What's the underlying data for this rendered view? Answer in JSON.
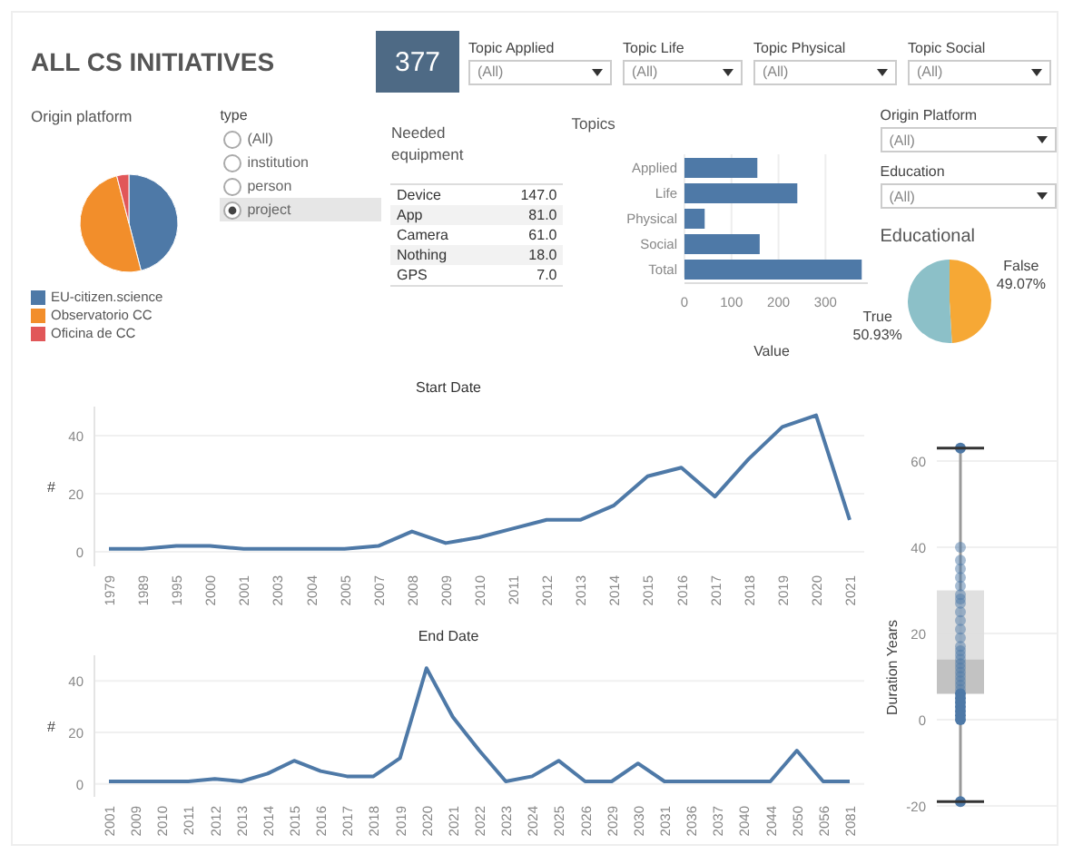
{
  "header": {
    "title": "ALL CS INITIATIVES",
    "count": "377"
  },
  "topic_filters": [
    {
      "label": "Topic Applied",
      "value": "(All)"
    },
    {
      "label": "Topic Life",
      "value": "(All)"
    },
    {
      "label": "Topic Physical",
      "value": "(All)"
    },
    {
      "label": "Topic Social",
      "value": "(All)"
    }
  ],
  "origin_platform": {
    "title": "Origin platform",
    "legend": [
      {
        "label": "EU-citizen.science",
        "color": "#4e79a7"
      },
      {
        "label": "Observatorio CC",
        "color": "#f28e2b"
      },
      {
        "label": "Oficina de CC",
        "color": "#e15759"
      }
    ]
  },
  "type_filter": {
    "title": "type",
    "options": [
      {
        "label": "(All)",
        "selected": false
      },
      {
        "label": "institution",
        "selected": false
      },
      {
        "label": "person",
        "selected": false
      },
      {
        "label": "project",
        "selected": true
      }
    ]
  },
  "needed_equipment": {
    "title": "Needed equipment",
    "rows": [
      {
        "name": "Device",
        "value": "147.0"
      },
      {
        "name": "App",
        "value": "81.0"
      },
      {
        "name": "Camera",
        "value": "61.0"
      },
      {
        "name": "Nothing",
        "value": "18.0"
      },
      {
        "name": "GPS",
        "value": "7.0"
      }
    ]
  },
  "topics": {
    "title": "Topics",
    "chart_data": {
      "type": "bar",
      "orientation": "horizontal",
      "xlabel": "Value",
      "categories": [
        "Applied",
        "Life",
        "Physical",
        "Social",
        "Total"
      ],
      "series": [
        {
          "color": "#4e79a7",
          "values": [
            155,
            240,
            43,
            160,
            377
          ]
        }
      ],
      "xticks": [
        0,
        100,
        200,
        300
      ],
      "xlim": [
        0,
        390
      ],
      "grid": true
    }
  },
  "side_filters": [
    {
      "label": "Origin Platform",
      "value": "(All)"
    },
    {
      "label": "Education",
      "value": "(All)"
    }
  ],
  "educational": {
    "title": "Educational",
    "chart_data": {
      "type": "pie",
      "categories": [
        "False",
        "True"
      ],
      "values": [
        49.07,
        50.93
      ],
      "value_labels": [
        "49.07%",
        "50.93%"
      ]
    }
  },
  "start_date": {
    "chart_data": {
      "type": "line",
      "title": "Start Date",
      "ylabel": "#",
      "categories": [
        "1979",
        "1989",
        "1995",
        "2000",
        "2001",
        "2003",
        "2004",
        "2005",
        "2007",
        "2008",
        "2009",
        "2010",
        "2011",
        "2012",
        "2013",
        "2014",
        "2015",
        "2016",
        "2017",
        "2018",
        "2019",
        "2020",
        "2021"
      ],
      "series": [
        {
          "color": "#4e79a7",
          "values": [
            1,
            1,
            2,
            2,
            1,
            1,
            1,
            1,
            2,
            7,
            3,
            5,
            8,
            11,
            11,
            16,
            26,
            29,
            19,
            32,
            43,
            47,
            11
          ]
        }
      ],
      "yticks": [
        0,
        20,
        40
      ],
      "ylim": [
        -5,
        50
      ],
      "grid": true
    }
  },
  "end_date": {
    "chart_data": {
      "type": "line",
      "title": "End Date",
      "ylabel": "#",
      "categories": [
        "2001",
        "2009",
        "2010",
        "2011",
        "2012",
        "2013",
        "2014",
        "2015",
        "2016",
        "2017",
        "2018",
        "2019",
        "2020",
        "2021",
        "2022",
        "2023",
        "2024",
        "2025",
        "2026",
        "2029",
        "2030",
        "2031",
        "2036",
        "2037",
        "2040",
        "2044",
        "2050",
        "2056",
        "2081"
      ],
      "series": [
        {
          "color": "#4e79a7",
          "values": [
            1,
            1,
            1,
            1,
            2,
            1,
            4,
            9,
            5,
            3,
            3,
            10,
            45,
            26,
            13,
            1,
            3,
            9,
            1,
            1,
            8,
            1,
            1,
            1,
            1,
            1,
            13,
            1,
            1
          ]
        }
      ],
      "yticks": [
        0,
        20,
        40
      ],
      "ylim": [
        -5,
        50
      ],
      "grid": true
    }
  },
  "duration": {
    "ylabel": "Duration Years",
    "yticks": [
      "60",
      "40",
      "20",
      "0",
      "-20"
    ]
  }
}
